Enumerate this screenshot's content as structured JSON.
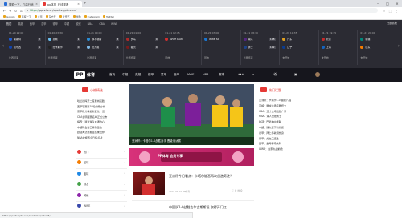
{
  "browser": {
    "tabs": [
      {
        "label": "搜狐一下，几站行消",
        "color": "#2b6fd6"
      },
      {
        "label": "pp体育_在线观看",
        "color": "#e53935"
      }
    ],
    "url": "pptv.tv.cn/sports.pptv.com/ ",
    "url_prefix": "https://",
    "bookmarks": [
      {
        "label": "Google"
      },
      {
        "label": "百度一下"
      },
      {
        "label": "主页"
      },
      {
        "label": "东方开"
      },
      {
        "label": "爱奇艺"
      },
      {
        "label": "优酷"
      },
      {
        "label": "Instagram"
      },
      {
        "label": "Twitter"
      }
    ]
  },
  "scorebar": {
    "tabs": [
      "热门",
      "英超",
      "西甲",
      "意甲",
      "德甲",
      "中超",
      "欧冠",
      "NBA",
      "CBA",
      "WWE"
    ],
    "all_matches": "全部赛程",
    "matches": [
      {
        "time": "01-20 22:00",
        "home": "莱斯特",
        "away": "切尔西",
        "home_score": "2",
        "away_score": "1",
        "status": "比赛结束",
        "hc": "#1f5ed8",
        "ac": "#1145b0"
      },
      {
        "time": "01-20 23:30",
        "home": "曼城",
        "away": "纽卡斯尔",
        "home_score": "1",
        "away_score": "0",
        "status": "比赛结束",
        "hc": "#6cc0f0",
        "ac": "#222222"
      },
      {
        "time": "01-21 00:00",
        "home": "那不勒斯",
        "away": "拉齐奥",
        "home_score": "3",
        "away_score": "1",
        "status": "比赛结束",
        "hc": "#2a8fd8",
        "ac": "#7fb9e6"
      },
      {
        "time": "01-21 01:00",
        "home": "罗马",
        "away": "都灵",
        "home_score": "0",
        "away_score": "0",
        "status": "比赛结束",
        "hc": "#b02a2a",
        "ac": "#7a1b1b"
      },
      {
        "time": "01-21 02:45",
        "home": "WWE RAW",
        "away": "",
        "home_score": "",
        "away_score": "",
        "status": "回放",
        "hc": "#d32f2f",
        "ac": "#d32f2f"
      },
      {
        "time": "01-21 03:00",
        "home": "WWE SD",
        "away": "",
        "home_score": "",
        "away_score": "",
        "status": "回放",
        "hc": "#1976d2",
        "ac": "#1976d2"
      },
      {
        "time": "01-21 08:30",
        "home": "湖人",
        "away": "勇士",
        "home_score": "108",
        "away_score": "102",
        "status": "比赛结束",
        "hc": "#552583",
        "ac": "#1d428a"
      },
      {
        "time": "01-21 19:35",
        "home": "广东",
        "away": "辽宁",
        "home_score": "",
        "away_score": "",
        "status": "未开始",
        "hc": "#e0a020",
        "ac": "#0b3d91"
      },
      {
        "time": "01-21 19:35",
        "home": "北京",
        "away": "上海",
        "home_score": "",
        "away_score": "",
        "status": "未开始",
        "hc": "#c62828",
        "ac": "#1565c0"
      },
      {
        "time": "01-21 20:00",
        "home": "新疆",
        "away": "山东",
        "home_score": "",
        "away_score": "",
        "status": "未开始",
        "hc": "#00897b",
        "ac": "#f57c00"
      }
    ]
  },
  "mainnav": {
    "logo_mark": "PP",
    "logo_text": "体育",
    "items": [
      "首页",
      "中超",
      "英超",
      "德甲",
      "意甲",
      "西甲",
      "WWE",
      "NBA",
      "赛事"
    ],
    "more": "•••",
    "actions": [
      {
        "icon": "search-icon"
      },
      {
        "icon": "gift-icon"
      },
      {
        "icon": "app-icon"
      },
      {
        "icon": "avatar"
      }
    ]
  },
  "left": {
    "hot_news_title": "小编精选",
    "news": [
      "哈兰德梅开二度曼城完胜",
      "西甲联赛第19轮前瞻分析",
      "意甲积分榜最新变化一览",
      "CBA全明星赛名单正式公布",
      "梅西：我对球队充满信心",
      "中超转会窗口重磅签约",
      "欧冠淘汰赛抽签结果出炉",
      "NBA常规赛今日焦点战"
    ],
    "categories": [
      {
        "label": "热门",
        "color": "#e53935"
      },
      {
        "label": "足球",
        "color": "#f57c00"
      },
      {
        "label": "篮球",
        "color": "#1e88e5"
      },
      {
        "label": "综合",
        "color": "#43a047"
      },
      {
        "label": "其他",
        "color": "#8e24aa"
      },
      {
        "label": "WWE",
        "color": "#3949ab"
      }
    ]
  },
  "center": {
    "hero_caption": "亚洲杯：卡塔尔1-0战胜对手 晋级淘汰赛",
    "banner_text": "PP体育 会员专享",
    "article1": {
      "title": "亚洲杯今日看点：卡塔尔能否再次创造奇迹？",
      "meta": "2019-01-21  PP体育",
      "icons": "♡ 0  ✉ 0"
    },
    "article2_title": "中国队1-0战胜吉尔吉斯斯坦 取得开门红"
  },
  "right": {
    "hot_topics_title": "热门话题",
    "topics": [
      "亚洲杯：卡塔尔1-0 晋级八强",
      "英超：曼城主场完胜纽卡",
      "CBA：辽宁主场险胜广东",
      "NBA：湖人击败勇士",
      "欧冠：巴萨抽中曼联",
      "中超：恒大签下新外援",
      "德甲：拜仁冬歇期热身",
      "意甲：尤文三连胜",
      "西甲：皇马客场失利",
      "WWE：皇家大战前瞻"
    ]
  },
  "statusbar": {
    "text": "https://sports.pptv.com/sportslive/video/3/..."
  }
}
